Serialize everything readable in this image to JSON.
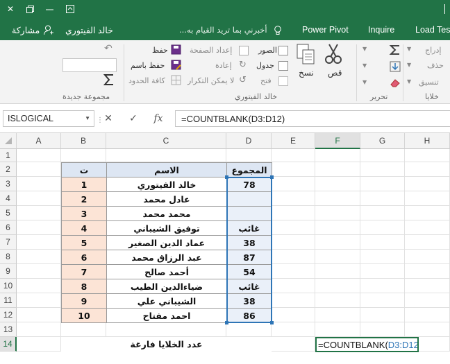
{
  "ribbon_tabs": {
    "load_test": "Load Tes",
    "inquire": "Inquire",
    "power_pivot": "Power Pivot",
    "tell_me": "أخبرني بما تريد القيام به...",
    "user_name": "خالد الفيتوري",
    "share": "مشاركة"
  },
  "ribbon": {
    "cells_group": {
      "insert": "إدراج",
      "delete": "حذف",
      "format": "تنسيق",
      "label": "خلايا"
    },
    "editing_group": {
      "label": "تحرير"
    },
    "clipboard": {
      "cut": "قص",
      "copy": "نسخ"
    },
    "khaled_group": {
      "pictures": "الصور",
      "table": "جدول",
      "open": "فتح",
      "page_setup": "إعداد الصفحة",
      "redo": "إعادة",
      "no_repeat": "لا يمكن التكرار",
      "save": "حفظ",
      "save_as": "حفظ باسم",
      "all_borders": "كافة الحدود",
      "label": "خالد الفيتوري"
    },
    "new_group": {
      "label": "مجموعة جديدة"
    }
  },
  "formula_bar": {
    "name_box": "ISLOGICAL",
    "fx": "fx",
    "formula": "=COUNTBLANK(D3:D12)"
  },
  "columns": [
    "A",
    "B",
    "C",
    "D",
    "E",
    "F",
    "G",
    "H"
  ],
  "rows": [
    "1",
    "2",
    "3",
    "4",
    "5",
    "6",
    "7",
    "8",
    "9",
    "10",
    "11",
    "12",
    "13",
    "14"
  ],
  "table": {
    "header_num": "ت",
    "header_name": "الاسم",
    "header_total": "المجموع",
    "rows": [
      {
        "n": "1",
        "name": "خالد الفيتوري",
        "total": "78"
      },
      {
        "n": "2",
        "name": "عادل محمد",
        "total": ""
      },
      {
        "n": "3",
        "name": "محمد محمد",
        "total": ""
      },
      {
        "n": "4",
        "name": "توفيق الشيباني",
        "total": "غائب"
      },
      {
        "n": "5",
        "name": "عماد الدين الصغير",
        "total": "38"
      },
      {
        "n": "6",
        "name": "عبد الرزاق محمد",
        "total": "87"
      },
      {
        "n": "7",
        "name": "أحمد صالح",
        "total": "54"
      },
      {
        "n": "8",
        "name": "ضياءالدين الطيب",
        "total": "غائب"
      },
      {
        "n": "9",
        "name": "الشيباني علي",
        "total": "38"
      },
      {
        "n": "10",
        "name": "احمد مفتاح",
        "total": "86"
      }
    ],
    "count_label": "عدد الخلايا  فارغة",
    "edit_prefix": "=COUNTBLANK(",
    "edit_ref": "D3:D12",
    "edit_suffix": ")"
  },
  "colors": {
    "excel_green": "#217346",
    "header_blue": "#dde6f3",
    "num_peach": "#fce4d6",
    "ref_blue": "#2e75b6"
  }
}
